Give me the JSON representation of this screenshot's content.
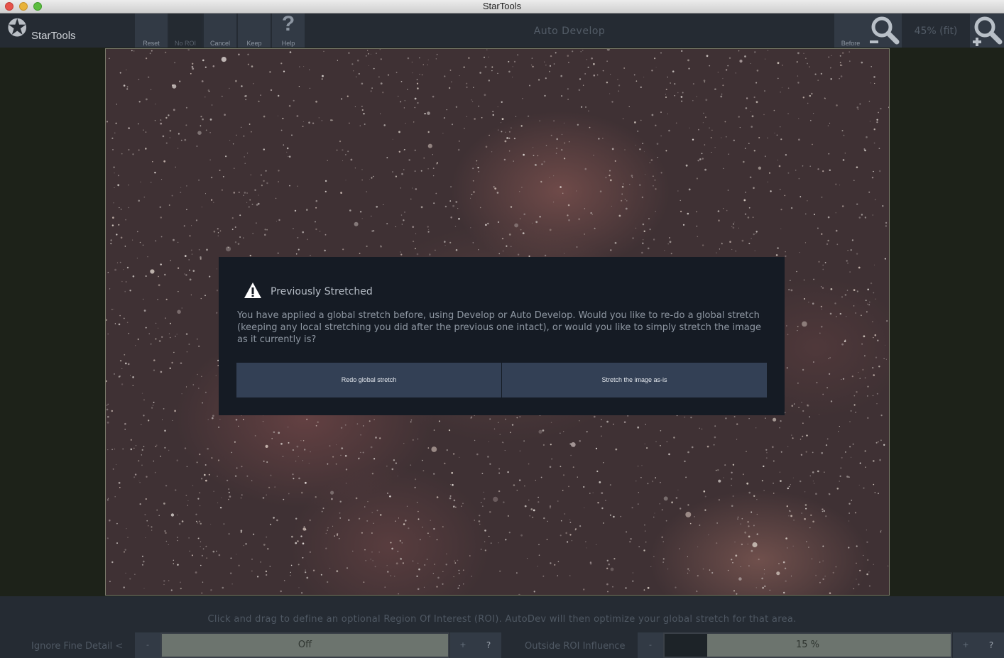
{
  "window": {
    "title": "StarTools"
  },
  "app": {
    "logo_text": "StarTools"
  },
  "toolbar": {
    "buttons": [
      {
        "label": "Reset"
      },
      {
        "label": "No ROI"
      },
      {
        "label": "Cancel"
      },
      {
        "label": "Keep"
      },
      {
        "label": "Help"
      }
    ],
    "mode_title": "Auto Develop",
    "before_label": "Before",
    "zoom_label": "45% (fit)"
  },
  "dialog": {
    "title": "Previously Stretched",
    "message": "You have applied a global stretch before, using Develop or Auto Develop. Would you like to re-do a global stretch (keeping any local stretching you did after the previous one intact), or would you like to simply stretch the image as it currently is?",
    "buttons": [
      "Redo global stretch",
      "Stretch the image as-is"
    ]
  },
  "bottom": {
    "hint": "Click and drag to define an optional Region Of Interest (ROI). AutoDev will then optimize your global stretch for that area.",
    "params": [
      {
        "label": "Ignore Fine Detail <",
        "value": "Off",
        "minus": "-",
        "plus": "+",
        "help": "?"
      },
      {
        "label": "Outside ROI Influence",
        "value": "15 %",
        "fraction": 0.15,
        "minus": "-",
        "plus": "+",
        "help": "?"
      }
    ]
  }
}
